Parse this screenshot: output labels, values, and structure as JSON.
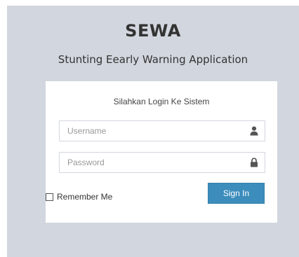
{
  "app": {
    "title": "SEWA",
    "subtitle": "Stunting Eearly Warning Application"
  },
  "login": {
    "message": "Silahkan Login Ke Sistem",
    "username": {
      "placeholder": "Username",
      "value": "",
      "icon": "user-icon"
    },
    "password": {
      "placeholder": "Password",
      "value": "",
      "icon": "lock-icon"
    },
    "remember_label": "Remember Me",
    "remember_checked": false,
    "submit_label": "Sign In"
  },
  "colors": {
    "background": "#d2d6de",
    "button": "#3c8dbc"
  }
}
